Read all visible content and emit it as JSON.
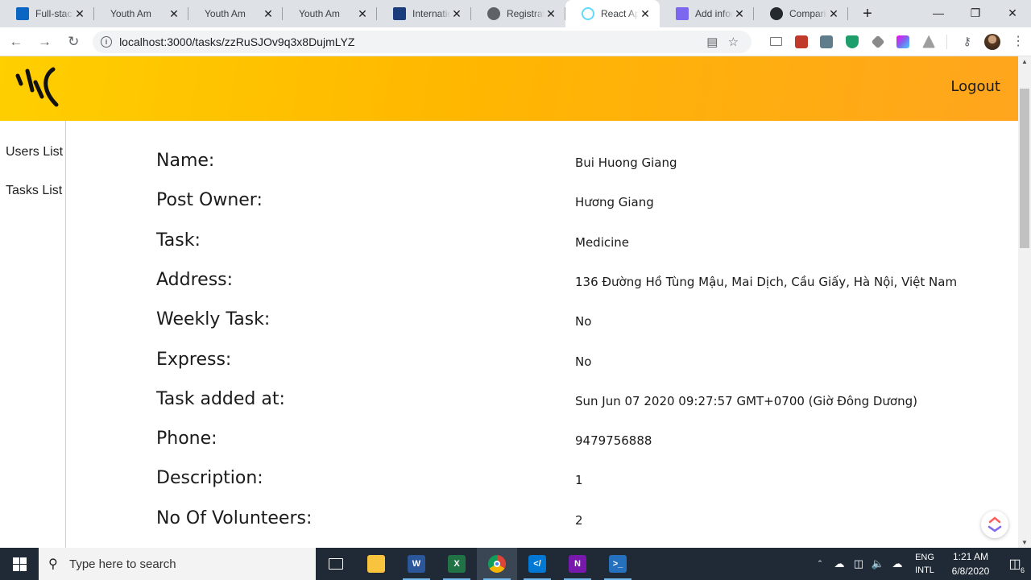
{
  "browser": {
    "tabs": [
      {
        "title": "Full-stack",
        "favicon": "linkedin-icon",
        "favicon_color": "#0a66c2",
        "active": false
      },
      {
        "title": "Youth Am",
        "favicon": "",
        "favicon_color": "",
        "active": false
      },
      {
        "title": "Youth Am",
        "favicon": "",
        "favicon_color": "",
        "active": false
      },
      {
        "title": "Youth Am",
        "favicon": "",
        "favicon_color": "",
        "active": false
      },
      {
        "title": "Internatio",
        "favicon": "person-icon",
        "favicon_color": "#1a3c7a",
        "active": false
      },
      {
        "title": "Registratio",
        "favicon": "globe-icon",
        "favicon_color": "#5f6368",
        "active": false
      },
      {
        "title": "React App",
        "favicon": "react-icon",
        "favicon_color": "#61dafb",
        "active": true
      },
      {
        "title": "Add inform",
        "favicon": "clickup-icon",
        "favicon_color": "#7b68ee",
        "active": false
      },
      {
        "title": "Comparin",
        "favicon": "github-icon",
        "favicon_color": "#24292e",
        "active": false
      }
    ],
    "url": "localhost:3000/tasks/zzRuSJOv9q3x8DujmLYZ"
  },
  "header": {
    "logout_label": "Logout"
  },
  "sidebar": {
    "items": [
      {
        "label": "Users List"
      },
      {
        "label": "Tasks List"
      }
    ]
  },
  "task_details": {
    "rows": [
      {
        "label": "Name:",
        "value": "Bui Huong Giang"
      },
      {
        "label": "Post Owner:",
        "value": "Hương Giang"
      },
      {
        "label": "Task:",
        "value": "Medicine"
      },
      {
        "label": "Address:",
        "value": "136 Đường Hồ Tùng Mậu, Mai Dịch, Cầu Giấy, Hà Nội, Việt Nam"
      },
      {
        "label": "Weekly Task:",
        "value": "No"
      },
      {
        "label": "Express:",
        "value": "No"
      },
      {
        "label": "Task added at:",
        "value": "Sun Jun 07 2020 09:27:57 GMT+0700 (Giờ Đông Dương)"
      },
      {
        "label": "Phone:",
        "value": "9479756888"
      },
      {
        "label": "Description:",
        "value": "1"
      },
      {
        "label": "No Of Volunteers:",
        "value": "2"
      }
    ]
  },
  "taskbar": {
    "search_placeholder": "Type here to search",
    "language_line1": "ENG",
    "language_line2": "INTL",
    "time": "1:21 AM",
    "date": "6/8/2020",
    "notification_count": "6"
  },
  "colors": {
    "header_gradient_start": "#ffcf00",
    "header_gradient_end": "#ffa51e",
    "taskbar": "#1f2a36"
  }
}
